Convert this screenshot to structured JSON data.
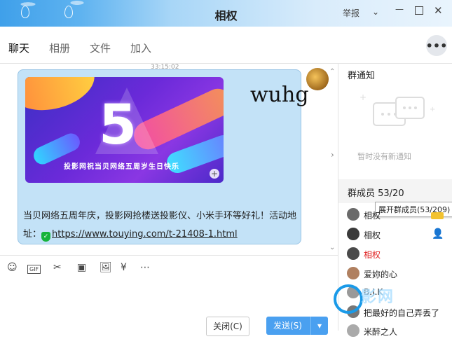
{
  "window": {
    "title": "相权",
    "report_label": "举报",
    "minimize_icon": "minimize-icon",
    "maximize_icon": "maximize-icon",
    "close_icon": "close-icon"
  },
  "tabs": [
    {
      "label": "聊天",
      "active": true
    },
    {
      "label": "相册",
      "active": false
    },
    {
      "label": "文件",
      "active": false
    },
    {
      "label": "加入",
      "active": false
    }
  ],
  "more_button": "•••",
  "chat": {
    "scroll_stub": "33:15:02",
    "message": {
      "banner_number": "5",
      "banner_caption": "投影网祝当贝网络五周岁生日快乐",
      "text": "当贝网络五周年庆，投影网抢楼送投影仪、小米手环等好礼！活动地址：",
      "link": "https://www.touying.com/t-21408-1.html"
    },
    "watermark": "wuhg"
  },
  "toolbar": {
    "tools": [
      "smile-icon",
      "gif-icon",
      "scissors-icon",
      "shake-icon",
      "image-icon",
      "red-packet-icon",
      "more-icon"
    ],
    "gif_label": "GIF"
  },
  "buttons": {
    "close": "关闭(C)",
    "send": "发送(S)",
    "send_arrow": "▾"
  },
  "sidebar": {
    "notice_title": "群通知",
    "notice_empty": "暂时没有新通知",
    "members_label": "群成员 53/20",
    "tooltip": "展开群成员(53/209)",
    "members": [
      {
        "name": "相权",
        "color": "#222"
      },
      {
        "name": "相权",
        "color": "#222"
      },
      {
        "name": "相权",
        "color": "#e02020"
      },
      {
        "name": "爱妳的心",
        "color": "#222"
      },
      {
        "name": "B.J.K",
        "color": "#222"
      },
      {
        "name": "把最好的自己弄丢了",
        "color": "#222"
      },
      {
        "name": "米醉之人",
        "color": "#222"
      }
    ],
    "watermark_logo": "影网"
  },
  "colors": {
    "accent": "#4aa0f0",
    "bubble": "#c3e2f7",
    "owner_name": "#e02020"
  }
}
